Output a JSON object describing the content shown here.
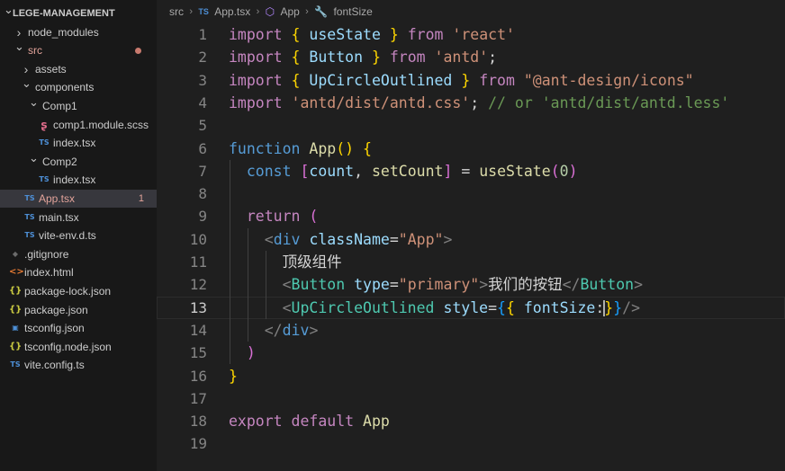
{
  "explorer": {
    "rows": [
      {
        "label": "LEGE-MANAGEMENT",
        "type": "root",
        "chevron": "down",
        "indent": 0
      },
      {
        "label": "node_modules",
        "type": "folder",
        "chevron": "right",
        "indent": 1
      },
      {
        "label": "src",
        "type": "folder",
        "chevron": "down",
        "indent": 1,
        "modified": true,
        "dot": true
      },
      {
        "label": "assets",
        "type": "folder",
        "chevron": "right",
        "indent": 2
      },
      {
        "label": "components",
        "type": "folder",
        "chevron": "down",
        "indent": 2
      },
      {
        "label": "Comp1",
        "type": "folder",
        "chevron": "down",
        "indent": 3
      },
      {
        "label": "comp1.module.scss",
        "type": "file",
        "icon": "scss-icon",
        "indent": 4
      },
      {
        "label": "index.tsx",
        "type": "file",
        "icon": "ts-icon",
        "indent": 4
      },
      {
        "label": "Comp2",
        "type": "folder",
        "chevron": "down",
        "indent": 3
      },
      {
        "label": "index.tsx",
        "type": "file",
        "icon": "ts-icon",
        "indent": 4
      },
      {
        "label": "App.tsx",
        "type": "file",
        "icon": "ts-icon",
        "indent": 2,
        "modified": true,
        "selected": true,
        "badge": "1"
      },
      {
        "label": "main.tsx",
        "type": "file",
        "icon": "ts-icon",
        "indent": 2
      },
      {
        "label": "vite-env.d.ts",
        "type": "file",
        "icon": "ts-icon",
        "indent": 2
      },
      {
        "label": ".gitignore",
        "type": "file",
        "icon": "git-icon",
        "indent": 0
      },
      {
        "label": "index.html",
        "type": "file",
        "icon": "html-icon",
        "indent": 0
      },
      {
        "label": "package-lock.json",
        "type": "file",
        "icon": "json-icon",
        "indent": 0
      },
      {
        "label": "package.json",
        "type": "file",
        "icon": "json-icon",
        "indent": 0
      },
      {
        "label": "tsconfig.json",
        "type": "file",
        "icon": "tsconfig-icon",
        "indent": 0
      },
      {
        "label": "tsconfig.node.json",
        "type": "file",
        "icon": "json-icon",
        "indent": 0
      },
      {
        "label": "vite.config.ts",
        "type": "file",
        "icon": "ts-icon",
        "indent": 0
      }
    ]
  },
  "breadcrumb": {
    "folder": "src",
    "file": "App.tsx",
    "file_icon": "TS",
    "symbol": "App",
    "symbol_icon": "cube-icon",
    "property": "fontSize",
    "property_icon": "wrench-icon"
  },
  "editor": {
    "active_line": 13,
    "line_numbers": [
      "1",
      "2",
      "3",
      "4",
      "5",
      "6",
      "7",
      "8",
      "9",
      "10",
      "11",
      "12",
      "13",
      "14",
      "15",
      "16",
      "17",
      "18",
      "19"
    ],
    "lines": [
      [
        [
          "kw",
          "import"
        ],
        [
          "pun",
          " "
        ],
        [
          "p1",
          "{"
        ],
        [
          "pun",
          " "
        ],
        [
          "var",
          "useState"
        ],
        [
          "pun",
          " "
        ],
        [
          "p1",
          "}"
        ],
        [
          "pun",
          " "
        ],
        [
          "kw",
          "from"
        ],
        [
          "pun",
          " "
        ],
        [
          "str",
          "'react'"
        ]
      ],
      [
        [
          "kw",
          "import"
        ],
        [
          "pun",
          " "
        ],
        [
          "p1",
          "{"
        ],
        [
          "pun",
          " "
        ],
        [
          "var",
          "Button"
        ],
        [
          "pun",
          " "
        ],
        [
          "p1",
          "}"
        ],
        [
          "pun",
          " "
        ],
        [
          "kw",
          "from"
        ],
        [
          "pun",
          " "
        ],
        [
          "str",
          "'antd'"
        ],
        [
          "pun",
          ";"
        ]
      ],
      [
        [
          "kw",
          "import"
        ],
        [
          "pun",
          " "
        ],
        [
          "p1",
          "{"
        ],
        [
          "pun",
          " "
        ],
        [
          "var",
          "UpCircleOutlined"
        ],
        [
          "pun",
          " "
        ],
        [
          "p1",
          "}"
        ],
        [
          "pun",
          " "
        ],
        [
          "kw",
          "from"
        ],
        [
          "pun",
          " "
        ],
        [
          "str",
          "\"@ant-design/icons\""
        ]
      ],
      [
        [
          "kw",
          "import"
        ],
        [
          "pun",
          " "
        ],
        [
          "str",
          "'antd/dist/antd.css'"
        ],
        [
          "pun",
          "; "
        ],
        [
          "cmt",
          "// or 'antd/dist/antd.less'"
        ]
      ],
      [],
      [
        [
          "kw2",
          "function"
        ],
        [
          "pun",
          " "
        ],
        [
          "fn",
          "App"
        ],
        [
          "p1",
          "()"
        ],
        [
          "pun",
          " "
        ],
        [
          "p1",
          "{"
        ]
      ],
      [
        [
          "pun",
          "  "
        ],
        [
          "kw2",
          "const"
        ],
        [
          "pun",
          " "
        ],
        [
          "p2",
          "["
        ],
        [
          "var",
          "count"
        ],
        [
          "pun",
          ", "
        ],
        [
          "fn",
          "setCount"
        ],
        [
          "p2",
          "]"
        ],
        [
          "pun",
          " = "
        ],
        [
          "fn",
          "useState"
        ],
        [
          "p2",
          "("
        ],
        [
          "num",
          "0"
        ],
        [
          "p2",
          ")"
        ]
      ],
      [],
      [
        [
          "pun",
          "  "
        ],
        [
          "kw",
          "return"
        ],
        [
          "pun",
          " "
        ],
        [
          "p2",
          "("
        ]
      ],
      [
        [
          "pun",
          "    "
        ],
        [
          "brk",
          "<"
        ],
        [
          "tag",
          "div"
        ],
        [
          "pun",
          " "
        ],
        [
          "var",
          "className"
        ],
        [
          "pun",
          "="
        ],
        [
          "str",
          "\"App\""
        ],
        [
          "brk",
          ">"
        ]
      ],
      [
        [
          "pun",
          "      "
        ],
        [
          "txt",
          "顶级组件"
        ]
      ],
      [
        [
          "pun",
          "      "
        ],
        [
          "brk",
          "<"
        ],
        [
          "ctag",
          "Button"
        ],
        [
          "pun",
          " "
        ],
        [
          "var",
          "type"
        ],
        [
          "pun",
          "="
        ],
        [
          "str",
          "\"primary\""
        ],
        [
          "brk",
          ">"
        ],
        [
          "txt",
          "我们的按钮"
        ],
        [
          "brk",
          "</"
        ],
        [
          "ctag",
          "Button"
        ],
        [
          "brk",
          ">"
        ]
      ],
      [
        [
          "pun",
          "      "
        ],
        [
          "brk",
          "<"
        ],
        [
          "ctag",
          "UpCircleOutlined"
        ],
        [
          "pun",
          " "
        ],
        [
          "var",
          "style"
        ],
        [
          "pun",
          "="
        ],
        [
          "p3",
          "{"
        ],
        [
          "p1",
          "{"
        ],
        [
          "pun",
          " "
        ],
        [
          "var",
          "fontSize"
        ],
        [
          "pun",
          ":"
        ],
        [
          "caret",
          ""
        ],
        [
          "p1",
          "}"
        ],
        [
          "p3",
          "}"
        ],
        [
          "brk",
          "/>"
        ]
      ],
      [
        [
          "pun",
          "    "
        ],
        [
          "brk",
          "</"
        ],
        [
          "tag",
          "div"
        ],
        [
          "brk",
          ">"
        ]
      ],
      [
        [
          "pun",
          "  "
        ],
        [
          "p2",
          ")"
        ]
      ],
      [
        [
          "p1",
          "}"
        ]
      ],
      [],
      [
        [
          "kw",
          "export"
        ],
        [
          "pun",
          " "
        ],
        [
          "kw",
          "default"
        ],
        [
          "pun",
          " "
        ],
        [
          "fn",
          "App"
        ]
      ],
      []
    ]
  }
}
